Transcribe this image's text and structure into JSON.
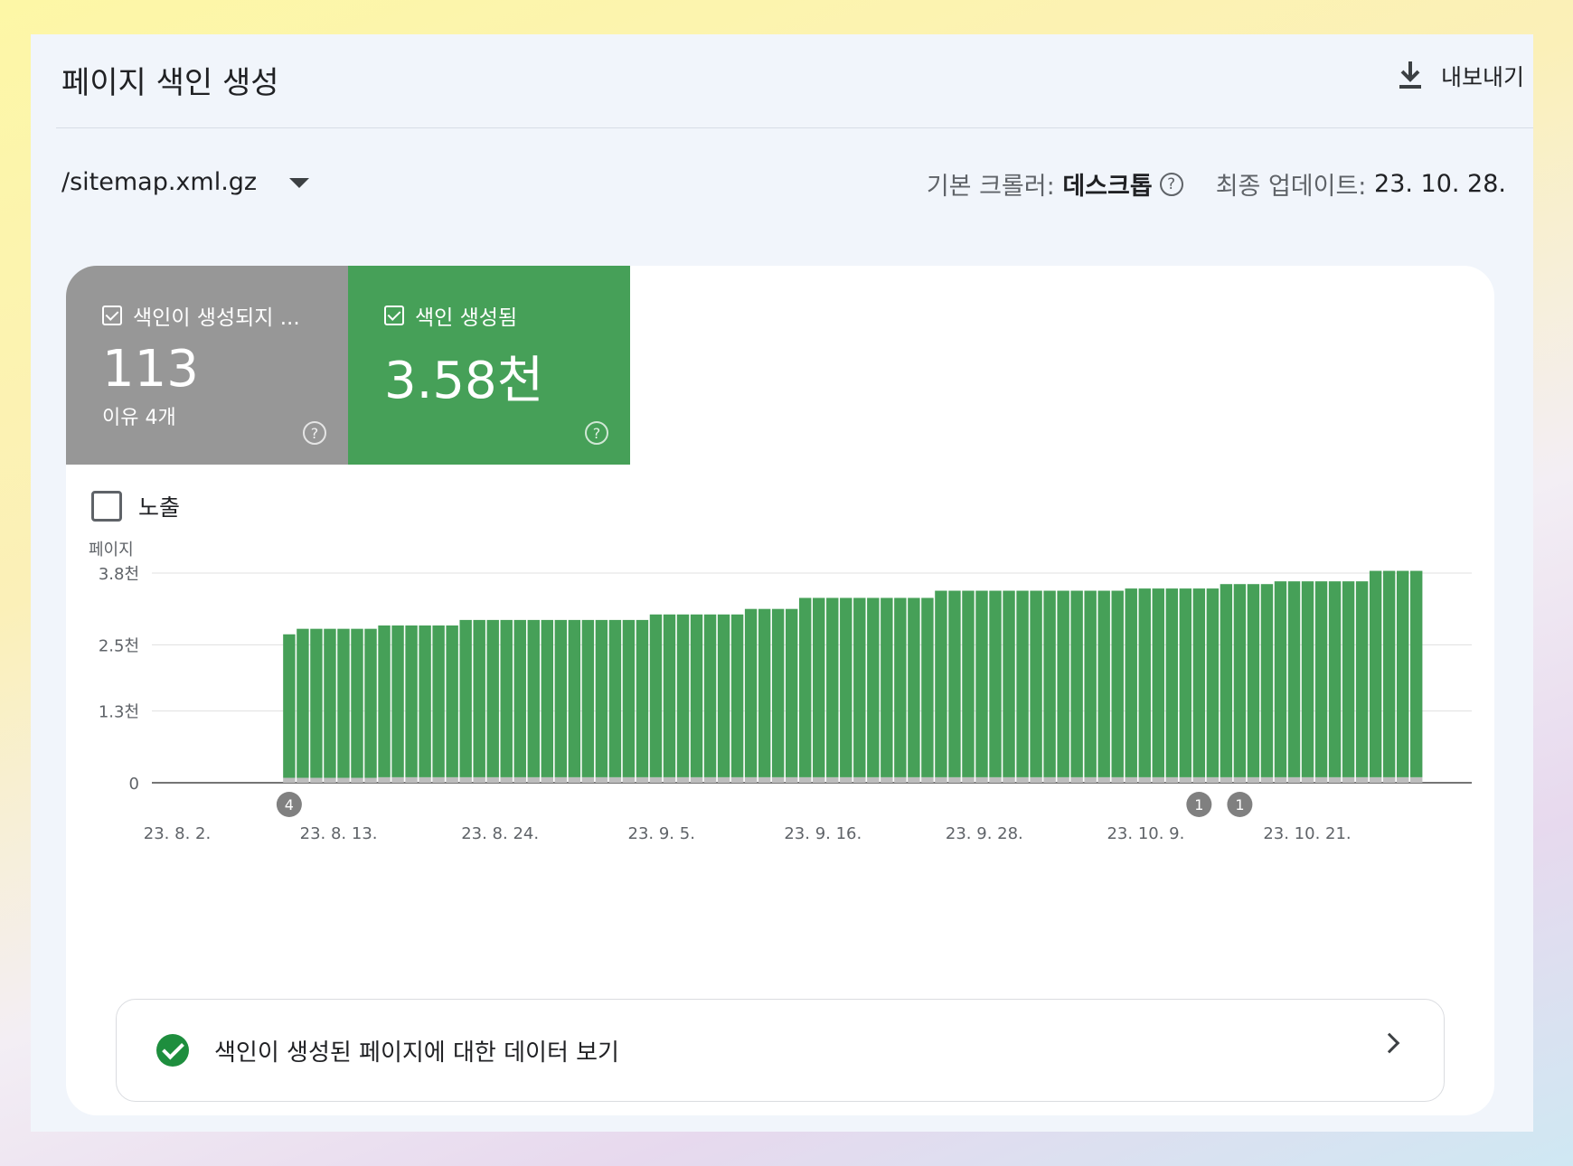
{
  "header": {
    "title": "페이지 색인 생성",
    "export_label": "내보내기"
  },
  "filter": {
    "sitemap": "/sitemap.xml.gz",
    "crawler_label": "기본 크롤러:",
    "crawler_value": "데스크톱",
    "updated_label": "최종 업데이트:",
    "updated_value": "23. 10. 28."
  },
  "tiles": {
    "not_indexed": {
      "label": "색인이 생성되지 ...",
      "value": "113",
      "sub": "이유 4개"
    },
    "indexed": {
      "label": "색인 생성됨",
      "value": "3.58천"
    }
  },
  "impressions_label": "노출",
  "data_link_label": "색인이 생성된 페이지에 대한 데이터 보기",
  "chart_data": {
    "type": "bar",
    "stacked": true,
    "ylabel": "페이지",
    "y_ticks": [
      {
        "value": 0,
        "label": "0"
      },
      {
        "value": 1300,
        "label": "1.3천"
      },
      {
        "value": 2500,
        "label": "2.5천"
      },
      {
        "value": 3800,
        "label": "3.8천"
      }
    ],
    "ylim": [
      0,
      3800
    ],
    "x_tick_labels": [
      "23. 8. 2.",
      "23. 8. 13.",
      "23. 8. 24.",
      "23. 9. 5.",
      "23. 9. 16.",
      "23. 9. 28.",
      "23. 10. 9.",
      "23. 10. 21."
    ],
    "empty_leading_days": 8,
    "series": [
      {
        "color": "#bdbdbd",
        "values": [
          90,
          90,
          90,
          90,
          90,
          90,
          90,
          100,
          100,
          100,
          100,
          100,
          100,
          100,
          100,
          100,
          100,
          100,
          100,
          100,
          100,
          100,
          100,
          100,
          100,
          100,
          100,
          100,
          100,
          100,
          100,
          100,
          100,
          100,
          100,
          100,
          100,
          100,
          100,
          100,
          100,
          100,
          100,
          100,
          100,
          100,
          100,
          100,
          100,
          100,
          100,
          100,
          100,
          100,
          100,
          100,
          100,
          100,
          100,
          100,
          100,
          100,
          100,
          100,
          100,
          100,
          100,
          100,
          100,
          100,
          100,
          100,
          100,
          100,
          100,
          100,
          100,
          100,
          100,
          100,
          100,
          100,
          100,
          100
        ]
      },
      {
        "color": "#46a058",
        "values": [
          2600,
          2700,
          2700,
          2700,
          2700,
          2700,
          2700,
          2750,
          2750,
          2750,
          2750,
          2750,
          2750,
          2850,
          2850,
          2850,
          2850,
          2850,
          2850,
          2850,
          2850,
          2850,
          2850,
          2850,
          2850,
          2850,
          2850,
          2950,
          2950,
          2950,
          2950,
          2950,
          2950,
          2950,
          3050,
          3050,
          3050,
          3050,
          3250,
          3250,
          3250,
          3250,
          3250,
          3250,
          3250,
          3250,
          3250,
          3250,
          3380,
          3380,
          3380,
          3380,
          3380,
          3380,
          3380,
          3380,
          3380,
          3380,
          3380,
          3380,
          3380,
          3380,
          3420,
          3420,
          3420,
          3420,
          3420,
          3420,
          3420,
          3500,
          3500,
          3500,
          3500,
          3550,
          3550,
          3550,
          3550,
          3550,
          3550,
          3550,
          3740,
          3740,
          3740,
          3740,
          3740,
          3740,
          3740
        ]
      }
    ],
    "annotations": [
      {
        "label": "4",
        "day_index": 8
      },
      {
        "label": "1",
        "day_index": 75
      },
      {
        "label": "1",
        "day_index": 78
      }
    ],
    "colors": {
      "indexed": "#46a058",
      "not_indexed": "#979797",
      "grid": "#e0e0e0",
      "axis": "#757575"
    }
  }
}
